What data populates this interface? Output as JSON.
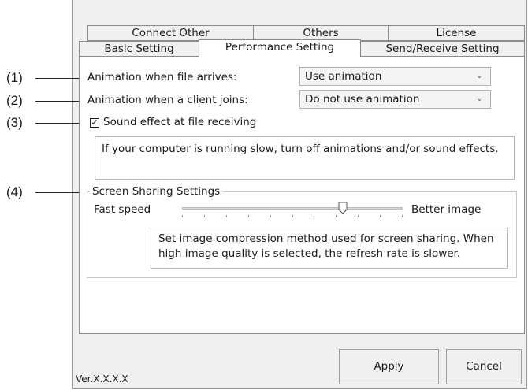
{
  "tabs_back": [
    "Connect Other",
    "Others",
    "License"
  ],
  "tabs_front": [
    "Basic Setting",
    "Performance Setting",
    "Send/Receive Setting"
  ],
  "callouts": [
    "(1)",
    "(2)",
    "(3)",
    "(4)"
  ],
  "settings": {
    "animation_file_label": "Animation when file arrives:",
    "animation_file_value": "Use animation",
    "animation_client_label": "Animation when a client  joins:",
    "animation_client_value": "Do not use animation",
    "sound_label": "Sound effect at file receiving",
    "sound_checked": true,
    "info_text": "If your computer is running slow, turn off animations and/or sound effects."
  },
  "screen_sharing": {
    "title": "Screen Sharing Settings",
    "left_label": "Fast speed",
    "right_label": "Better image",
    "slider_value_fraction": 0.73,
    "tick_count": 11,
    "description": "Set image compression method used for screen sharing. When high image quality is selected, the refresh rate is slower."
  },
  "buttons": {
    "apply": "Apply",
    "cancel": "Cancel"
  },
  "version": "Ver.X.X.X.X"
}
